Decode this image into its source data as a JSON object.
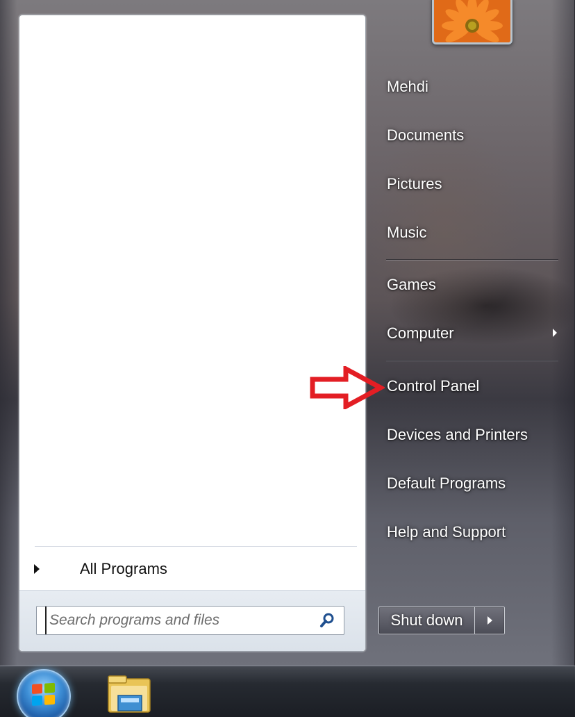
{
  "user": {
    "name": "Mehdi"
  },
  "left_pane": {
    "all_programs_label": "All Programs",
    "search": {
      "placeholder": "Search programs and files",
      "value": ""
    }
  },
  "right_pane": {
    "items": [
      {
        "label": "Mehdi"
      },
      {
        "label": "Documents"
      },
      {
        "label": "Pictures"
      },
      {
        "label": "Music"
      },
      {
        "label": "Games"
      },
      {
        "label": "Computer",
        "has_submenu": true
      },
      {
        "label": "Control Panel",
        "highlighted_by_annotation": true
      },
      {
        "label": "Devices and Printers"
      },
      {
        "label": "Default Programs"
      },
      {
        "label": "Help and Support"
      }
    ]
  },
  "shutdown": {
    "label": "Shut down"
  },
  "annotation": {
    "color": "#e31e24",
    "icon": "red-arrow-icon"
  },
  "taskbar": {
    "icons": [
      "windows-start-orb-icon",
      "windows-explorer-icon"
    ]
  },
  "colors": {
    "menu_text": "#ffffff",
    "left_pane_bg": "#ffffff",
    "search_strip_bg": "#dbe2ea"
  }
}
